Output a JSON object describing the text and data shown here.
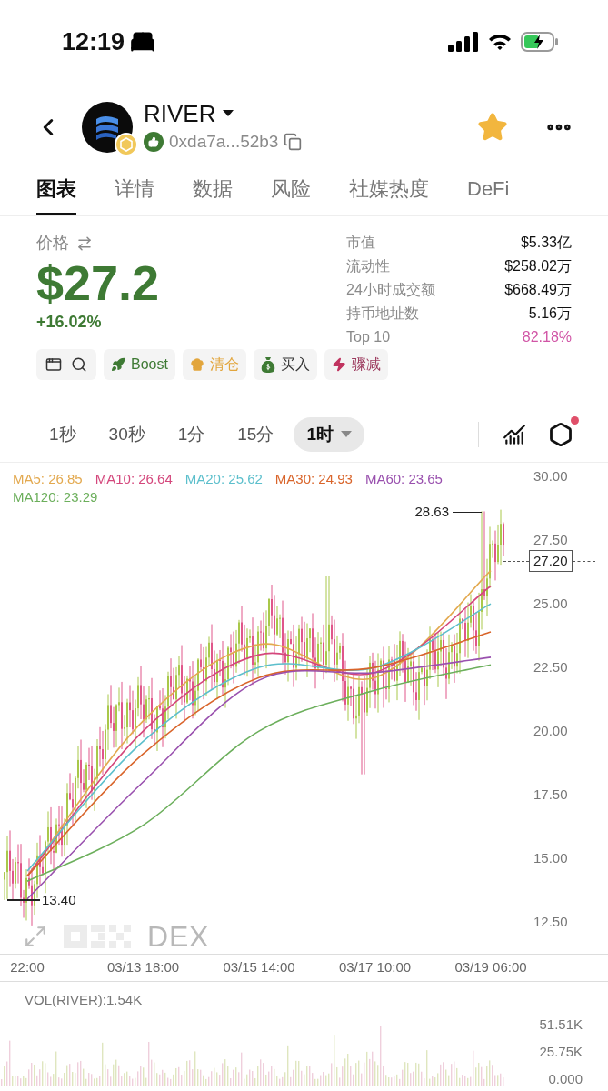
{
  "status_bar": {
    "time": "12:19"
  },
  "header": {
    "token": "RIVER",
    "address": "0xda7a...52b3",
    "favorite": true
  },
  "tabs": [
    {
      "label": "图表",
      "selected": true
    },
    {
      "label": "详情",
      "selected": false
    },
    {
      "label": "数据",
      "selected": false
    },
    {
      "label": "风险",
      "selected": false
    },
    {
      "label": "社媒热度",
      "selected": false
    },
    {
      "label": "DeFi",
      "selected": false
    }
  ],
  "price": {
    "label": "价格",
    "value": "$27.2",
    "change": "+16.02%"
  },
  "stats": [
    {
      "label": "市值",
      "value": "$5.33亿",
      "kind": "plain"
    },
    {
      "label": "流动性",
      "value": "$258.02万",
      "kind": "plain"
    },
    {
      "label": "24小时成交额",
      "value": "$668.49万",
      "kind": "plain"
    },
    {
      "label": "持币地址数",
      "value": "5.16万",
      "kind": "plain"
    },
    {
      "label": "Top 10",
      "value": "82.18%",
      "kind": "highlight"
    }
  ],
  "actions": [
    {
      "kind": "tools"
    },
    {
      "kind": "boost",
      "label": "Boost"
    },
    {
      "kind": "clear",
      "label": "清仓"
    },
    {
      "kind": "buy",
      "label": "买入"
    },
    {
      "kind": "drop",
      "label": "骤减"
    }
  ],
  "intervals": [
    {
      "label": "1秒",
      "selected": false
    },
    {
      "label": "30秒",
      "selected": false
    },
    {
      "label": "1分",
      "selected": false
    },
    {
      "label": "15分",
      "selected": false
    },
    {
      "label": "1时",
      "selected": true
    }
  ],
  "settings_alert": true,
  "chart": {
    "ma": [
      {
        "label": "MA5: 26.85",
        "color": "#e3a94f"
      },
      {
        "label": "MA10: 26.64",
        "color": "#d4477c"
      },
      {
        "label": "MA20: 25.62",
        "color": "#5cbfcc"
      },
      {
        "label": "MA30: 24.93",
        "color": "#d9652b"
      },
      {
        "label": "MA60: 23.65",
        "color": "#9950ae"
      },
      {
        "label": "MA120: 23.29",
        "color": "#6caf5c"
      }
    ],
    "chart_data": {
      "type": "line",
      "ylim": [
        11.25,
        30.54
      ],
      "categories": [
        "22:00",
        "03/13 18:00",
        "03/15 14:00",
        "03/17 10:00",
        "03/19 06:00"
      ],
      "yticks": [
        {
          "value": 30,
          "label": "30.00"
        },
        {
          "value": 27.5,
          "label": "27.50"
        },
        {
          "value": 25,
          "label": "25.00"
        },
        {
          "value": 22.5,
          "label": "22.50"
        },
        {
          "value": 20,
          "label": "20.00"
        },
        {
          "value": 17.5,
          "label": "17.50"
        },
        {
          "value": 15,
          "label": "15.00"
        },
        {
          "value": 12.5,
          "label": "12.50"
        }
      ],
      "series": [
        {
          "color": "#e3a94f",
          "values": [
            14.3,
            20.4,
            23.4,
            22.1,
            26.3
          ]
        },
        {
          "color": "#d4477c",
          "values": [
            14.3,
            20.0,
            23.0,
            22.3,
            25.7
          ]
        },
        {
          "color": "#5cbfcc",
          "values": [
            14.5,
            19.6,
            22.5,
            22.5,
            25.0
          ]
        },
        {
          "color": "#d9652b",
          "values": [
            14.3,
            19.1,
            22.1,
            22.5,
            23.9
          ]
        },
        {
          "color": "#9950ae",
          "values": [
            13.4,
            18.0,
            22.0,
            22.3,
            22.9
          ]
        },
        {
          "color": "#6caf5c",
          "values": [
            14.1,
            16.3,
            20.0,
            21.6,
            22.6
          ]
        }
      ]
    },
    "high_marker": "28.63",
    "low_marker": "13.40",
    "last_price": "27.20",
    "watermark": "DEX"
  },
  "volume": {
    "label": "VOL(RIVER):1.54K",
    "y_labels": [
      "51.51K",
      "25.75K",
      "0.000"
    ]
  }
}
